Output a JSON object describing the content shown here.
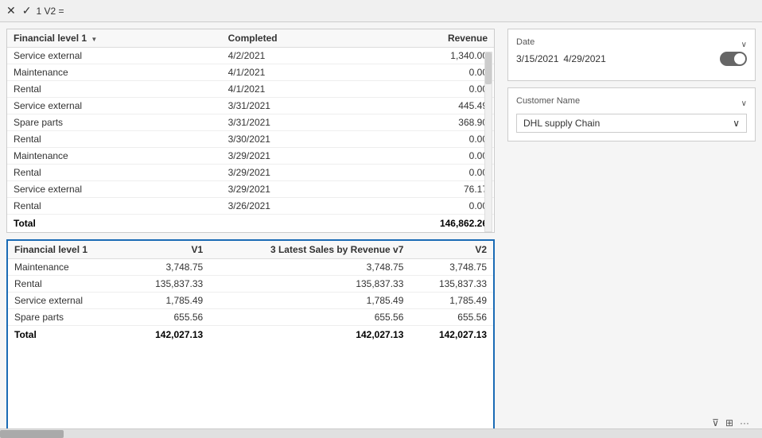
{
  "toolbar": {
    "close_icon": "✕",
    "check_icon": "✓",
    "formula_text": "1  V2  ="
  },
  "top_table": {
    "columns": [
      {
        "label": "Financial level 1",
        "align": "left"
      },
      {
        "label": "Completed",
        "align": "left"
      },
      {
        "label": "Revenue",
        "align": "right"
      }
    ],
    "rows": [
      {
        "col1": "Service external",
        "col2": "4/2/2021",
        "col3": "1,340.00"
      },
      {
        "col1": "Maintenance",
        "col2": "4/1/2021",
        "col3": "0.00"
      },
      {
        "col1": "Rental",
        "col2": "4/1/2021",
        "col3": "0.00"
      },
      {
        "col1": "Service external",
        "col2": "3/31/2021",
        "col3": "445.49"
      },
      {
        "col1": "Spare parts",
        "col2": "3/31/2021",
        "col3": "368.90"
      },
      {
        "col1": "Rental",
        "col2": "3/30/2021",
        "col3": "0.00"
      },
      {
        "col1": "Maintenance",
        "col2": "3/29/2021",
        "col3": "0.00"
      },
      {
        "col1": "Rental",
        "col2": "3/29/2021",
        "col3": "0.00"
      },
      {
        "col1": "Service external",
        "col2": "3/29/2021",
        "col3": "76.17"
      },
      {
        "col1": "Rental",
        "col2": "3/26/2021",
        "col3": "0.00"
      }
    ],
    "footer": {
      "label": "Total",
      "value": "146,862.26"
    }
  },
  "bottom_table": {
    "columns": [
      {
        "label": "Financial level 1",
        "align": "left"
      },
      {
        "label": "V1",
        "align": "right"
      },
      {
        "label": "3 Latest Sales by Revenue v7",
        "align": "right"
      },
      {
        "label": "V2",
        "align": "right"
      }
    ],
    "rows": [
      {
        "col1": "Maintenance",
        "col2": "3,748.75",
        "col3": "3,748.75",
        "col4": "3,748.75"
      },
      {
        "col1": "Rental",
        "col2": "135,837.33",
        "col3": "135,837.33",
        "col4": "135,837.33"
      },
      {
        "col1": "Service external",
        "col2": "1,785.49",
        "col3": "1,785.49",
        "col4": "1,785.49"
      },
      {
        "col1": "Spare parts",
        "col2": "655.56",
        "col3": "655.56",
        "col4": "655.56"
      }
    ],
    "footer": {
      "label": "Total",
      "col2": "142,027.13",
      "col3": "142,027.13",
      "col4": "142,027.13"
    }
  },
  "date_filter": {
    "label": "Date",
    "start_date": "3/15/2021",
    "end_date": "4/29/2021",
    "chevron": "∨"
  },
  "customer_filter": {
    "label": "Customer Name",
    "selected_value": "DHL supply Chain",
    "chevron": "∨",
    "value_chevron": "∨"
  },
  "icon_bar": {
    "filter_icon": "⊽",
    "table_icon": "⊞",
    "more_icon": "···"
  }
}
